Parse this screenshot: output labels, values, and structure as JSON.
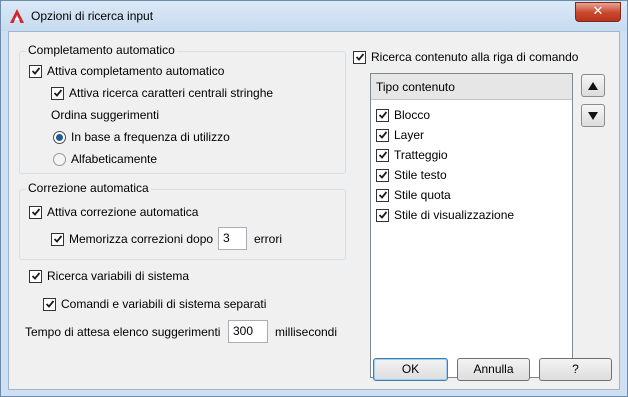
{
  "window": {
    "title": "Opzioni di ricerca input",
    "close_glyph": "✕"
  },
  "autocomplete": {
    "group_label": "Completamento automatico",
    "enable_label": "Attiva completamento automatico",
    "enable_checked": true,
    "midstring_label": "Attiva ricerca caratteri centrali stringhe",
    "midstring_checked": true,
    "sort_label": "Ordina suggerimenti",
    "sort_frequency_label": "In base a frequenza di utilizzo",
    "sort_alpha_label": "Alfabeticamente",
    "sort_selected": "frequency"
  },
  "autocorrect": {
    "group_label": "Correzione automatica",
    "enable_label": "Attiva correzione automatica",
    "enable_checked": true,
    "remember_label": "Memorizza correzioni dopo",
    "remember_checked": true,
    "remember_value": "3",
    "remember_suffix": "errori"
  },
  "sysvars": {
    "search_label": "Ricerca variabili di sistema",
    "search_checked": true,
    "separate_label": "Comandi e variabili di sistema separati",
    "separate_checked": true
  },
  "delay": {
    "label": "Tempo di attesa elenco suggerimenti",
    "value": "300",
    "suffix": "millisecondi"
  },
  "content_search": {
    "label": "Ricerca contenuto alla riga di comando",
    "checked": true,
    "list_header": "Tipo contenuto",
    "items": [
      {
        "label": "Blocco",
        "checked": true
      },
      {
        "label": "Layer",
        "checked": true
      },
      {
        "label": "Tratteggio",
        "checked": true
      },
      {
        "label": "Stile testo",
        "checked": true
      },
      {
        "label": "Stile quota",
        "checked": true
      },
      {
        "label": "Stile di visualizzazione",
        "checked": true
      }
    ]
  },
  "buttons": {
    "ok": "OK",
    "cancel": "Annulla",
    "help": "?"
  },
  "colors": {
    "accent": "#1d5b99",
    "close_red": "#c9462c",
    "app_icon_red": "#d3262b"
  },
  "icons": {
    "app": "autocad-a-icon",
    "up": "triangle-up-icon",
    "down": "triangle-down-icon",
    "check": "check-icon"
  }
}
